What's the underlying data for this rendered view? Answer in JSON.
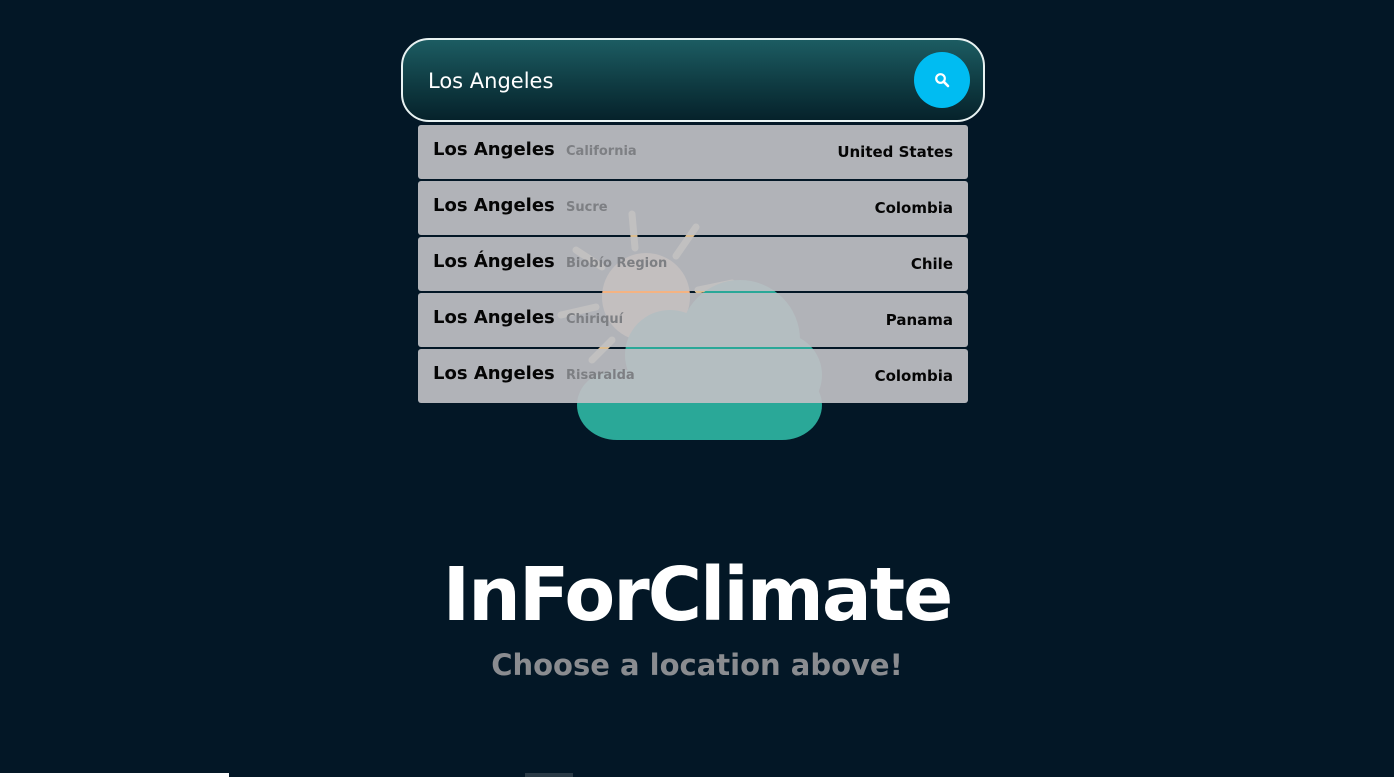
{
  "search": {
    "value": "Los Angeles",
    "placeholder": ""
  },
  "suggestions": [
    {
      "city": "Los Angeles",
      "region": "California",
      "country": "United States"
    },
    {
      "city": "Los Angeles",
      "region": "Sucre",
      "country": "Colombia"
    },
    {
      "city": "Los Ángeles",
      "region": "Biobío Region",
      "country": "Chile"
    },
    {
      "city": "Los Angeles",
      "region": "Chiriquí",
      "country": "Panama"
    },
    {
      "city": "Los Angeles",
      "region": "Risaralda",
      "country": "Colombia"
    }
  ],
  "app": {
    "title": "InForClimate",
    "subtitle": "Choose a location above!"
  },
  "icons": {
    "search_button": "search-icon",
    "illustration": "partly-cloudy-icon"
  },
  "colors": {
    "background": "#031726",
    "search_button": "#00bcf2",
    "cloud": "#2aa898",
    "sun": "#f4b382"
  }
}
